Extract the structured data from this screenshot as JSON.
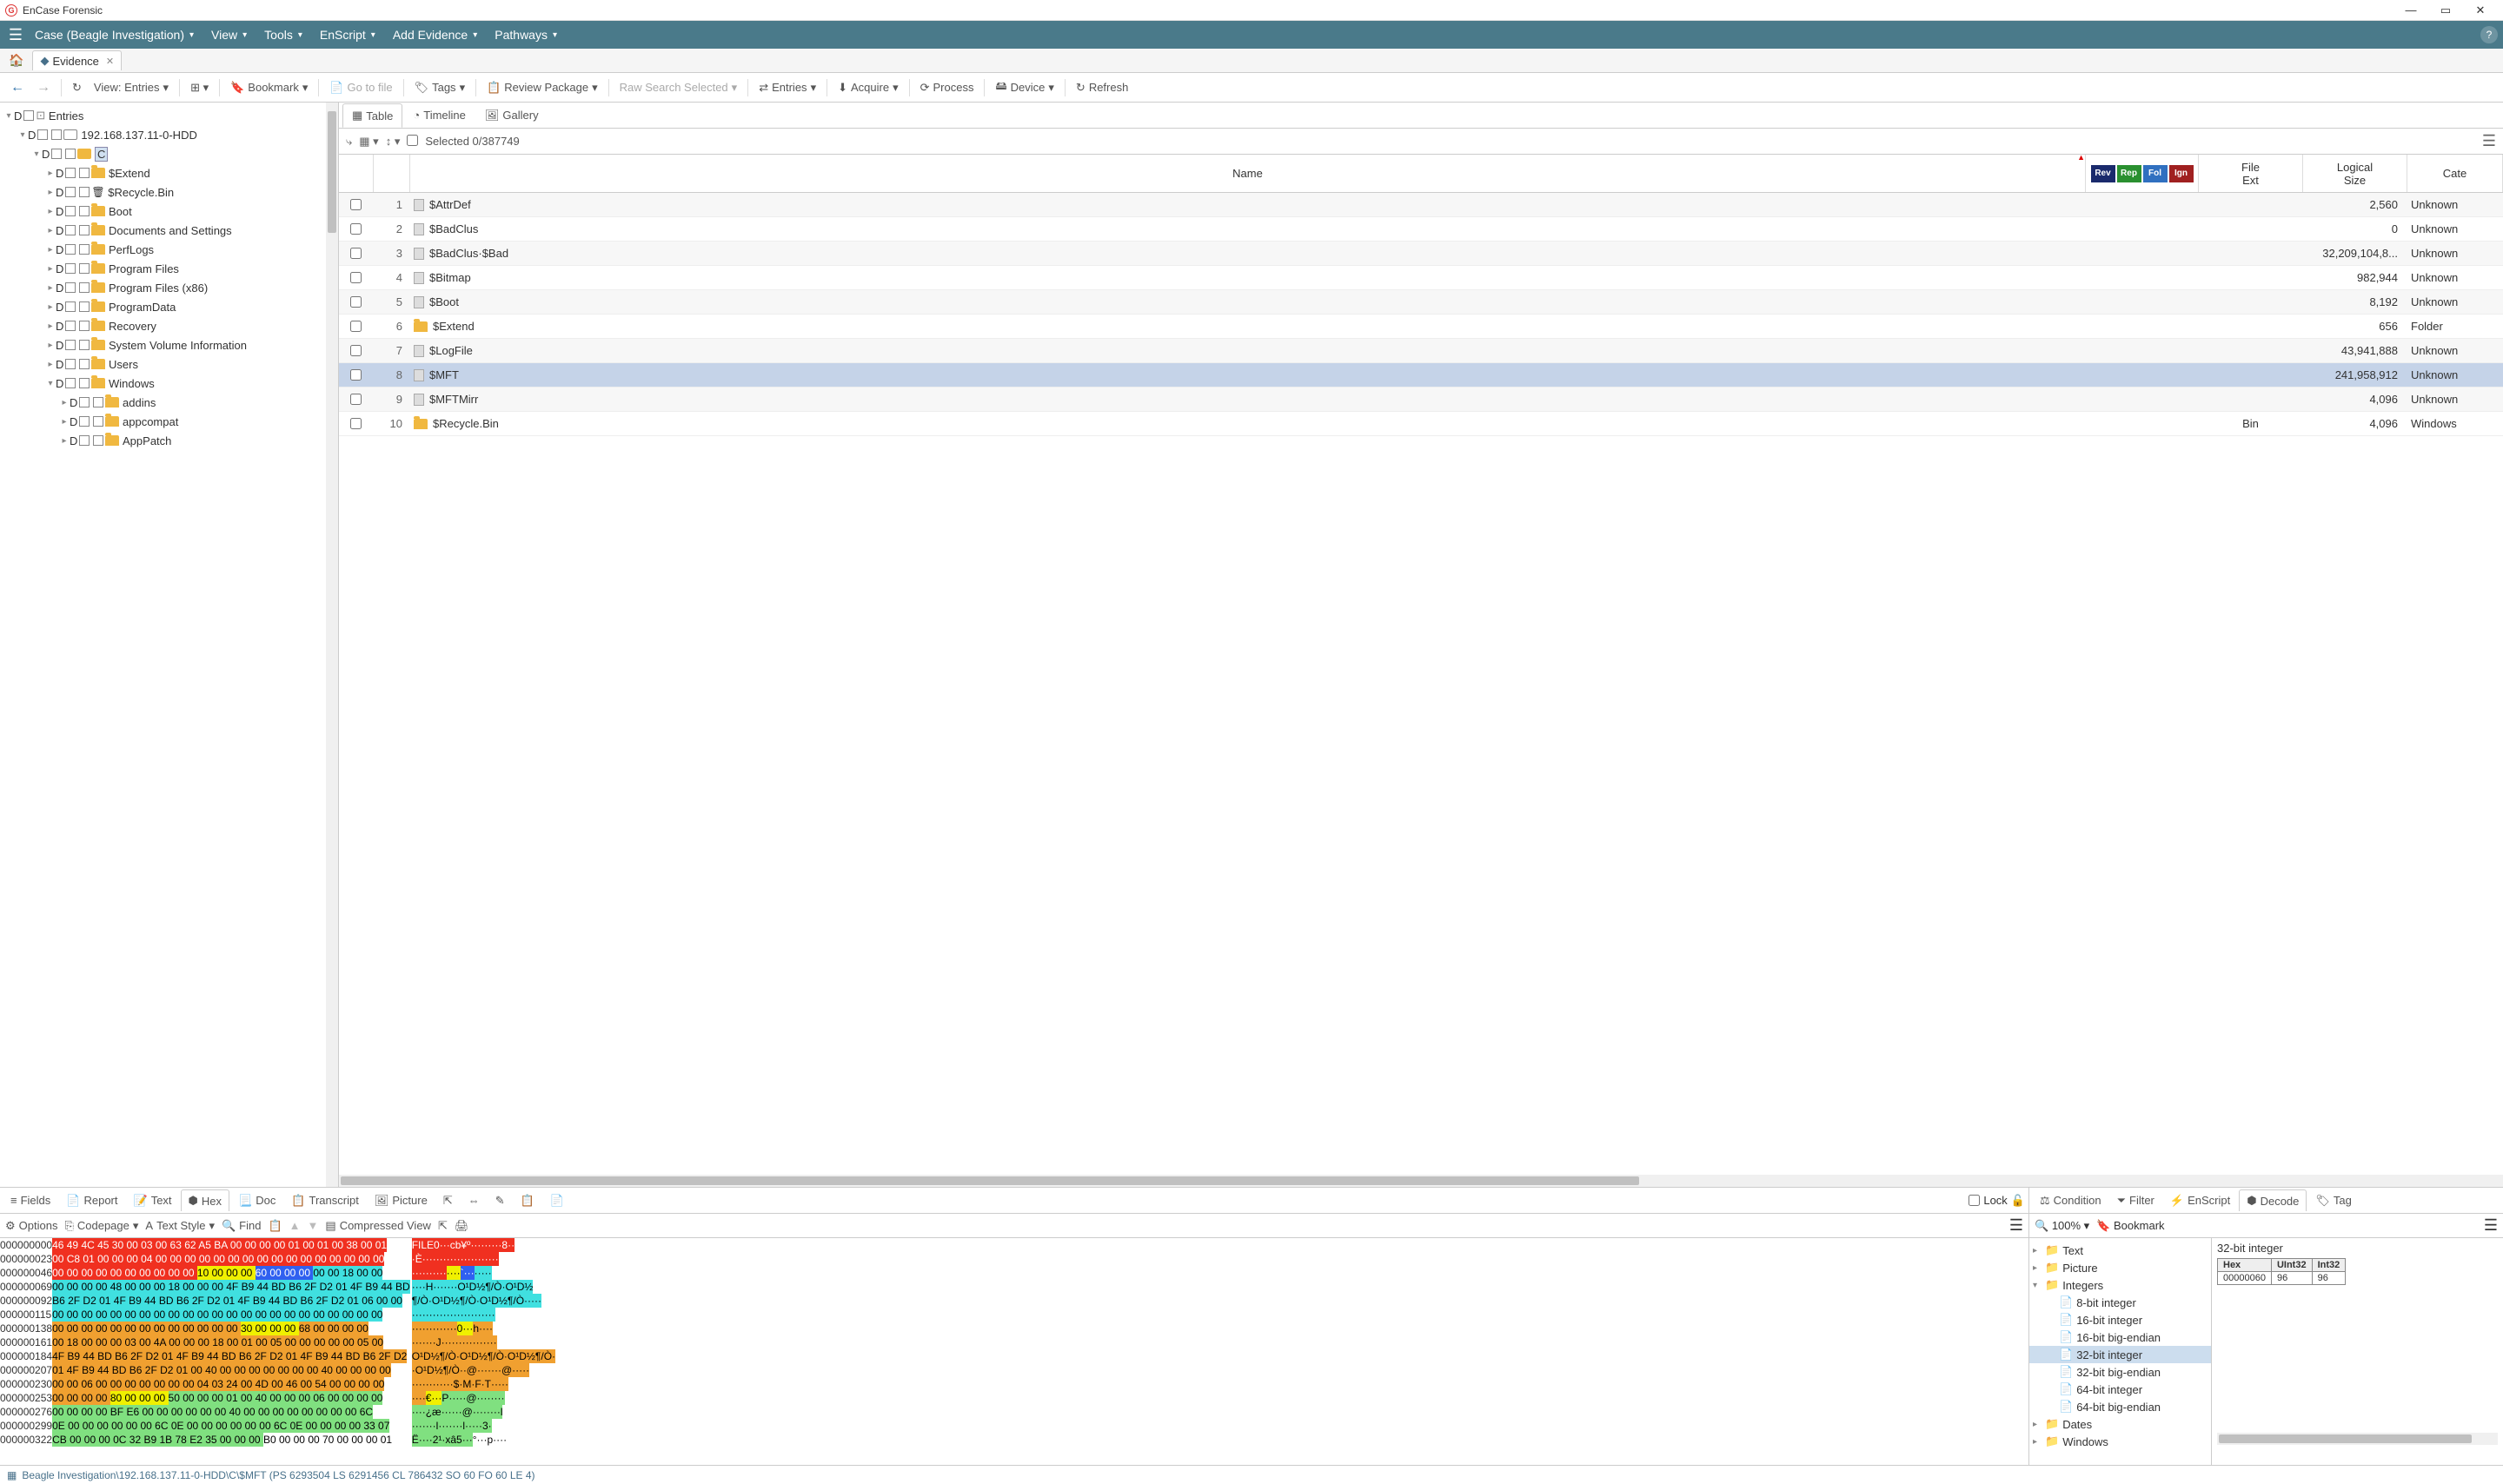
{
  "app": {
    "title": "EnCase Forensic"
  },
  "menu": {
    "case": "Case (Beagle Investigation)",
    "view": "View",
    "tools": "Tools",
    "enscript": "EnScript",
    "addevidence": "Add Evidence",
    "pathways": "Pathways"
  },
  "tabs": {
    "evidence": "Evidence"
  },
  "toolbar": {
    "view_entries": "View: Entries",
    "bookmark": "Bookmark",
    "gotofile": "Go to file",
    "tags": "Tags",
    "review": "Review Package",
    "rawsearch": "Raw Search Selected",
    "entries": "Entries",
    "acquire": "Acquire",
    "process": "Process",
    "device": "Device",
    "refresh": "Refresh"
  },
  "tree": {
    "root": "Entries",
    "hdd": "192.168.137.11-0-HDD",
    "drive": "C",
    "folders": [
      "$Extend",
      "$Recycle.Bin",
      "Boot",
      "Documents and Settings",
      "PerfLogs",
      "Program Files",
      "Program Files (x86)",
      "ProgramData",
      "Recovery",
      "System Volume Information",
      "Users",
      "Windows"
    ],
    "windows_children": [
      "addins",
      "appcompat",
      "AppPatch"
    ]
  },
  "tabletabs": {
    "table": "Table",
    "timeline": "Timeline",
    "gallery": "Gallery"
  },
  "tabletools": {
    "selected": "Selected 0/387749"
  },
  "gridhead": {
    "name": "Name",
    "badges": [
      "Rev",
      "Rep",
      "Fol",
      "Ign"
    ],
    "badge_colors": [
      "#1a2a6c",
      "#2a9030",
      "#3070c0",
      "#a02020"
    ],
    "ext": "File\nExt",
    "size": "Logical\nSize",
    "cat": "Cate"
  },
  "rows": [
    {
      "n": 1,
      "name": "$AttrDef",
      "icon": "file",
      "size": "2,560",
      "cat": "Unknown"
    },
    {
      "n": 2,
      "name": "$BadClus",
      "icon": "file",
      "size": "0",
      "cat": "Unknown"
    },
    {
      "n": 3,
      "name": "$BadClus·$Bad",
      "icon": "file",
      "size": "32,209,104,8...",
      "cat": "Unknown"
    },
    {
      "n": 4,
      "name": "$Bitmap",
      "icon": "file",
      "size": "982,944",
      "cat": "Unknown"
    },
    {
      "n": 5,
      "name": "$Boot",
      "icon": "file",
      "size": "8,192",
      "cat": "Unknown"
    },
    {
      "n": 6,
      "name": "$Extend",
      "icon": "folder",
      "size": "656",
      "cat": "Folder"
    },
    {
      "n": 7,
      "name": "$LogFile",
      "icon": "file",
      "size": "43,941,888",
      "cat": "Unknown"
    },
    {
      "n": 8,
      "name": "$MFT",
      "icon": "file",
      "size": "241,958,912",
      "cat": "Unknown",
      "sel": true
    },
    {
      "n": 9,
      "name": "$MFTMirr",
      "icon": "file",
      "size": "4,096",
      "cat": "Unknown"
    },
    {
      "n": 10,
      "name": "$Recycle.Bin",
      "icon": "folder",
      "ext": "Bin",
      "size": "4,096",
      "cat": "Windows"
    }
  ],
  "hextabs": {
    "fields": "Fields",
    "report": "Report",
    "text": "Text",
    "hex": "Hex",
    "doc": "Doc",
    "transcript": "Transcript",
    "picture": "Picture",
    "lock": "Lock"
  },
  "hextools": {
    "options": "Options",
    "codepage": "Codepage",
    "textstyle": "Text Style",
    "find": "Find",
    "compressed": "Compressed View"
  },
  "hex": {
    "offsets": [
      "000000000",
      "000000023",
      "000000046",
      "000000069",
      "000000092",
      "000000115",
      "000000138",
      "000000161",
      "000000184",
      "000000207",
      "000000230",
      "000000253",
      "000000276",
      "000000299",
      "000000322"
    ],
    "lines": [
      {
        "cls": "hx-red",
        "hex": "46 49 4C 45 30 00 03 00 63 62 A5 BA 00 00 00 00 01 00 01 00 38 00 01",
        "asc": "FILE0···cb¥º·········8··"
      },
      {
        "cls": "hx-red",
        "hex": "00 C8 01 00 00 00 04 00 00 00 00 00 00 00 00 00 00 00 00 00 00 00 00",
        "asc": "·È······················"
      },
      {
        "cls": "multi",
        "segs": [
          {
            "c": "hx-red",
            "t": "00 00 00 00 00 00 00 00 00 00 "
          },
          {
            "c": "hx-yellow",
            "t": "10 00 00 00 "
          },
          {
            "c": "hx-blue",
            "t": "60 00 00 00 "
          },
          {
            "c": "hx-cyan",
            "t": "00 00 18 00 00"
          }
        ],
        "asc_segs": [
          {
            "c": "hx-red",
            "t": "··········"
          },
          {
            "c": "hx-yellow",
            "t": "····"
          },
          {
            "c": "hx-blue",
            "t": "`···"
          },
          {
            "c": "hx-cyan",
            "t": "·····"
          }
        ]
      },
      {
        "cls": "hx-cyan",
        "hex": "00 00 00 00 48 00 00 00 18 00 00 00 4F B9 44 BD B6 2F D2 01 4F B9 44 BD",
        "asc": "····H·······O¹D½¶/Ò·O¹D½"
      },
      {
        "cls": "hx-cyan",
        "hex": "B6 2F D2 01 4F B9 44 BD B6 2F D2 01 4F B9 44 BD B6 2F D2 01 06 00 00",
        "asc": "¶/Ò·O¹D½¶/Ò·O¹D½¶/Ò·····"
      },
      {
        "cls": "hx-cyan",
        "hex": "00 00 00 00 00 00 00 00 00 00 00 00 00 00 00 00 00 00 00 00 00 00 00",
        "asc": "························"
      },
      {
        "cls": "multi",
        "segs": [
          {
            "c": "hx-orange",
            "t": "00 00 00 00 00 00 00 00 00 00 00 00 00 "
          },
          {
            "c": "hx-yellow",
            "t": "30 00 00 00 "
          },
          {
            "c": "hx-orange",
            "t": "68 00 00 00 00"
          }
        ],
        "asc_segs": [
          {
            "c": "hx-orange",
            "t": "·············"
          },
          {
            "c": "hx-yellow",
            "t": "0···"
          },
          {
            "c": "hx-orange",
            "t": "h····"
          }
        ]
      },
      {
        "cls": "hx-orange",
        "hex": "00 18 00 00 00 03 00 4A 00 00 00 18 00 01 00 05 00 00 00 00 00 05 00",
        "asc": "·······J················"
      },
      {
        "cls": "hx-orange",
        "hex": "4F B9 44 BD B6 2F D2 01 4F B9 44 BD B6 2F D2 01 4F B9 44 BD B6 2F D2",
        "asc": "O¹D½¶/Ò·O¹D½¶/Ò·O¹D½¶/Ò·"
      },
      {
        "cls": "hx-orange",
        "hex": "01 4F B9 44 BD B6 2F D2 01 00 40 00 00 00 00 00 00 00 40 00 00 00 00",
        "asc": "·O¹D½¶/Ò··@·······@·····"
      },
      {
        "cls": "hx-orange",
        "hex": "00 00 06 00 00 00 00 00 00 00 04 03 24 00 4D 00 46 00 54 00 00 00 00",
        "asc": "············$·M·F·T·····"
      },
      {
        "cls": "multi",
        "segs": [
          {
            "c": "hx-orange",
            "t": "00 00 00 00 "
          },
          {
            "c": "hx-yellow",
            "t": "80 00 00 00 "
          },
          {
            "c": "hx-green",
            "t": "50 00 00 00 01 00 40 00 00 00 06 00 00 00 00"
          }
        ],
        "asc_segs": [
          {
            "c": "hx-orange",
            "t": "····"
          },
          {
            "c": "hx-yellow",
            "t": "€···"
          },
          {
            "c": "hx-green",
            "t": "P·····@········"
          }
        ]
      },
      {
        "cls": "hx-green",
        "hex": "00 00 00 00 BF E6 00 00 00 00 00 00 40 00 00 00 00 00 00 00 00 6C",
        "asc": "····¿æ······@········l"
      },
      {
        "cls": "hx-green",
        "hex": "0E 00 00 00 00 00 00 6C 0E 00 00 00 00 00 00 6C 0E 00 00 00 00 33 07",
        "asc": "·······l·······l·····3·"
      },
      {
        "cls": "multi",
        "segs": [
          {
            "c": "hx-green",
            "t": "CB 00 00 00 0C 32 B9 1B 78 E2 35 00 00 00 "
          },
          {
            "c": "hx-white",
            "t": "B0 00 00 00 70 00 00 00 01"
          }
        ],
        "asc_segs": [
          {
            "c": "hx-green",
            "t": "Ë····2¹·xâ5···"
          },
          {
            "c": "hx-white",
            "t": "°···p····"
          }
        ]
      }
    ]
  },
  "decodetabs": {
    "condition": "Condition",
    "filter": "Filter",
    "enscript": "EnScript",
    "decode": "Decode",
    "tag": "Tag"
  },
  "decodetools": {
    "zoom": "100%",
    "bookmark": "Bookmark"
  },
  "dectree": {
    "text": "Text",
    "picture": "Picture",
    "integers": "Integers",
    "int_children": [
      "8-bit integer",
      "16-bit integer",
      "16-bit big-endian",
      "32-bit integer",
      "32-bit big-endian",
      "64-bit integer",
      "64-bit big-endian"
    ],
    "dates": "Dates",
    "windows": "Windows"
  },
  "decdetail": {
    "title": "32-bit integer",
    "headers": [
      "Hex",
      "UInt32",
      "Int32"
    ],
    "row": [
      "00000060",
      "96",
      "96"
    ]
  },
  "status": "Beagle Investigation\\192.168.137.11-0-HDD\\C\\$MFT (PS 6293504 LS 6291456 CL 786432 SO 60 FO 60 LE 4)"
}
